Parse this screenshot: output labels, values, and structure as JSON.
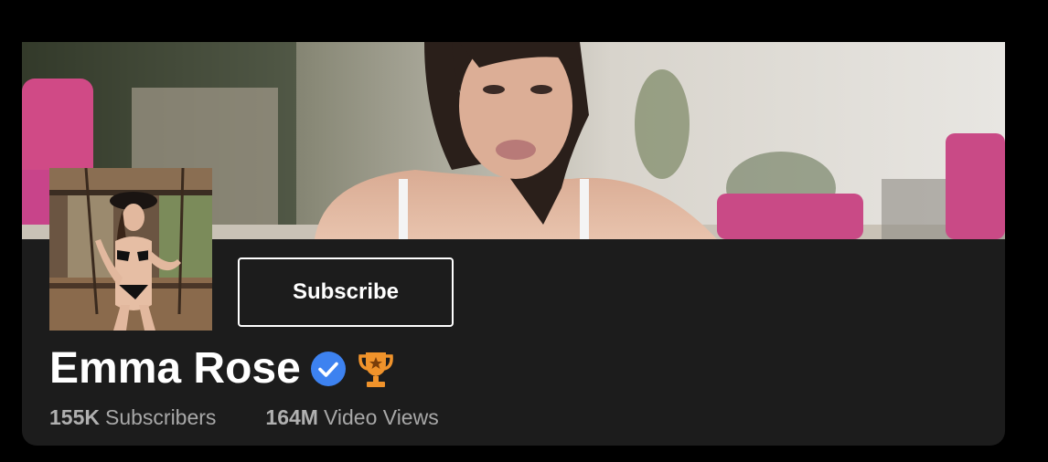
{
  "channel": {
    "name": "Emma Rose",
    "verified_icon": "verified-check-icon",
    "award_icon": "trophy-icon",
    "subscribe_label": "Subscribe",
    "stats": [
      {
        "value": "155K",
        "label": "Subscribers"
      },
      {
        "value": "164M",
        "label": "Video Views"
      }
    ]
  },
  "colors": {
    "background": "#000000",
    "card": "#1c1c1c",
    "verified_badge": "#3d82f0",
    "trophy": "#f0932b",
    "stat_text": "#a8a8a8"
  }
}
